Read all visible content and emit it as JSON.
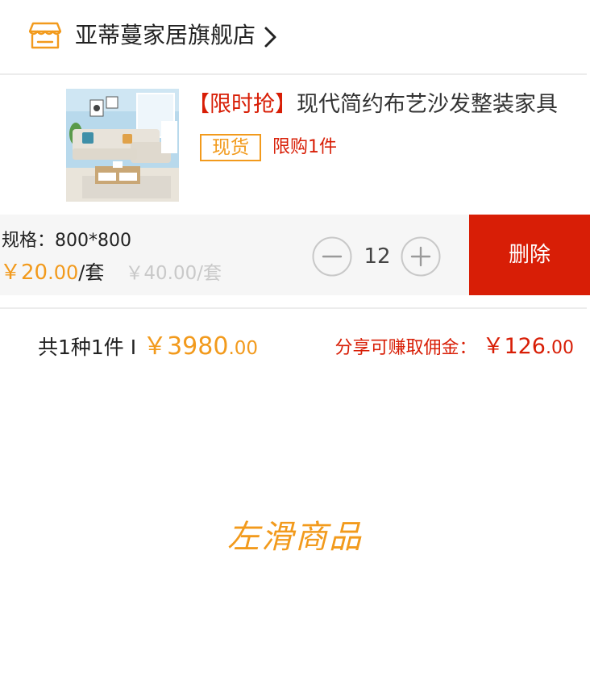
{
  "store": {
    "name": "亚蒂蔓家居旗舰店",
    "icon": "store-icon",
    "chevron_icon": "chevron-right-icon"
  },
  "product": {
    "tag": "【限时抢】",
    "title": "现代简约布艺沙发整装家具",
    "stock_badge": "现货",
    "limit_text": "限购1件",
    "thumbnail": "sofa-product-image"
  },
  "spec": {
    "label": "规格：800*800",
    "price_symbol": "￥",
    "price_int": "20",
    "price_cents": ".00",
    "price_unit": "/套",
    "original_price": "￥40.00/套"
  },
  "quantity": {
    "value": "12",
    "minus_icon": "minus-icon",
    "plus_icon": "plus-icon"
  },
  "actions": {
    "delete_label": "删除"
  },
  "summary": {
    "count_text": "共1种1件 I",
    "total_symbol": "￥",
    "total_int": "3980",
    "total_cents": ".00",
    "commission_label": "分享可赚取佣金：",
    "commission_symbol": "￥",
    "commission_int": "126",
    "commission_cents": ".00"
  },
  "hint": {
    "swipe_text": "左滑商品"
  },
  "colors": {
    "accent_orange": "#f29a1c",
    "accent_red": "#d81e06",
    "band_bg": "#f6f6f6",
    "divider": "#ececec"
  }
}
